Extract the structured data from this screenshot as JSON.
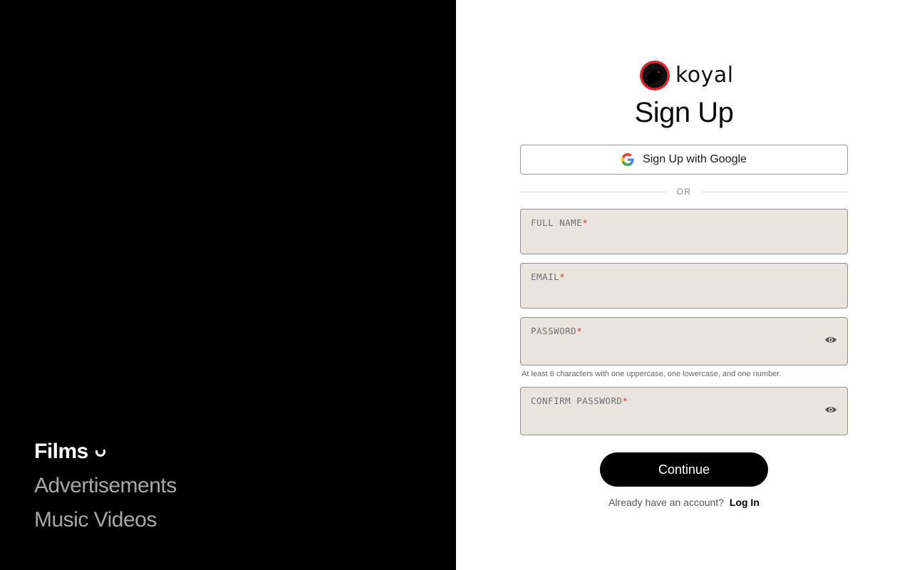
{
  "sidebar": {
    "categories": [
      {
        "label": "Films",
        "active": true
      },
      {
        "label": "Advertisements",
        "active": false
      },
      {
        "label": "Music Videos",
        "active": false
      }
    ]
  },
  "brand": {
    "name": "koyal",
    "logo_icon": "raven-logo-icon"
  },
  "signup": {
    "title": "Sign Up",
    "google_button": "Sign Up with Google",
    "divider": "OR",
    "fields": {
      "full_name": {
        "label": "FULL NAME",
        "required_mark": "*",
        "value": ""
      },
      "email": {
        "label": "EMAIL",
        "required_mark": "*",
        "value": ""
      },
      "password": {
        "label": "PASSWORD",
        "required_mark": "*",
        "value": "",
        "hint": "At least 6 characters with one uppercase, one lowercase, and one number."
      },
      "confirm_password": {
        "label": "CONFIRM PASSWORD",
        "required_mark": "*",
        "value": ""
      }
    },
    "continue_button": "Continue",
    "login_prompt": "Already have an account?",
    "login_link": "Log In"
  },
  "colors": {
    "accent": "#000000",
    "field_bg": "#e9e4dd",
    "required": "#d03030",
    "logo_red": "#e0242b"
  }
}
